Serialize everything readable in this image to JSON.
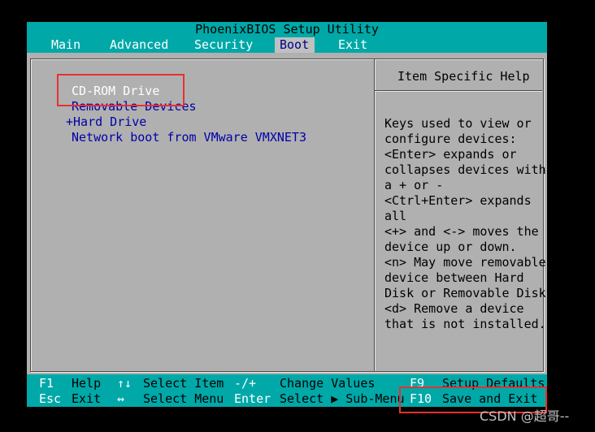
{
  "title": "PhoenixBIOS Setup Utility",
  "menu": [
    {
      "label": "Main"
    },
    {
      "label": "Advanced"
    },
    {
      "label": "Security"
    },
    {
      "label": "Boot",
      "active": true
    },
    {
      "label": "Exit"
    }
  ],
  "boot_order": [
    {
      "label": "CD-ROM Drive",
      "selected": true
    },
    {
      "label": "Removable Devices"
    },
    {
      "label": "+Hard Drive"
    },
    {
      "label": "Network boot from VMware VMXNET3"
    }
  ],
  "help": {
    "title": "Item Specific Help",
    "lines": [
      "Keys used to view or",
      "configure devices:",
      "<Enter> expands or",
      "collapses devices with",
      "a + or -",
      "<Ctrl+Enter> expands",
      "all",
      "<+> and <-> moves the",
      "device up or down.",
      "<n> May move removable",
      "device between Hard",
      "Disk or Removable Disk",
      "<d> Remove a device",
      "that is not installed."
    ]
  },
  "footer": {
    "f1": {
      "key": "F1",
      "label": "Help"
    },
    "esc": {
      "key": "Esc",
      "label": "Exit"
    },
    "updown": {
      "key": "↑↓",
      "label": "Select Item"
    },
    "leftright": {
      "key": "↔",
      "label": "Select Menu"
    },
    "plusminus": {
      "key": "-/+",
      "label": "Change Values"
    },
    "enter": {
      "key": "Enter",
      "label": "Select ▶ Sub-Menu"
    },
    "f9": {
      "key": "F9",
      "label": "Setup Defaults"
    },
    "f10": {
      "key": "F10",
      "label": "Save and Exit"
    }
  },
  "watermark": "CSDN @超哥--",
  "colors": {
    "teal": "#00a8a8",
    "panel_gray": "#b0b0b0",
    "item_blue": "#0000a8",
    "highlight_red": "#e83030"
  }
}
